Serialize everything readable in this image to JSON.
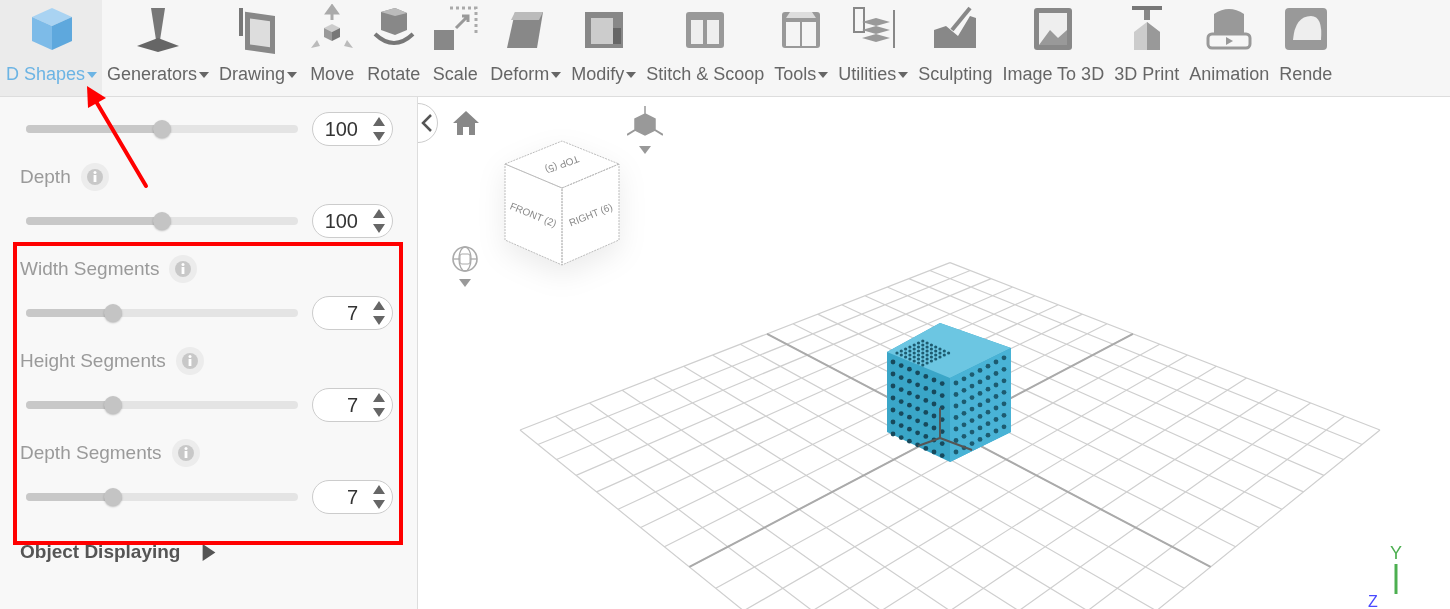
{
  "toolbar": [
    {
      "label": "D Shapes",
      "dropdown": true,
      "selected": true
    },
    {
      "label": "Generators",
      "dropdown": true,
      "selected": false
    },
    {
      "label": "Drawing",
      "dropdown": true,
      "selected": false
    },
    {
      "label": "Move",
      "dropdown": false,
      "selected": false
    },
    {
      "label": "Rotate",
      "dropdown": false,
      "selected": false
    },
    {
      "label": "Scale",
      "dropdown": false,
      "selected": false
    },
    {
      "label": "Deform",
      "dropdown": true,
      "selected": false
    },
    {
      "label": "Modify",
      "dropdown": true,
      "selected": false
    },
    {
      "label": "Stitch & Scoop",
      "dropdown": false,
      "selected": false
    },
    {
      "label": "Tools",
      "dropdown": true,
      "selected": false
    },
    {
      "label": "Utilities",
      "dropdown": true,
      "selected": false
    },
    {
      "label": "Sculpting",
      "dropdown": false,
      "selected": false
    },
    {
      "label": "Image To 3D",
      "dropdown": false,
      "selected": false
    },
    {
      "label": "3D Print",
      "dropdown": false,
      "selected": false
    },
    {
      "label": "Animation",
      "dropdown": false,
      "selected": false
    },
    {
      "label": "Rende",
      "dropdown": false,
      "selected": false
    }
  ],
  "panel": {
    "parameters": [
      {
        "level": 0.5,
        "value": "100"
      },
      {
        "label": "Depth",
        "level": 0.5,
        "value": "100"
      },
      {
        "label": "Width Segments",
        "level": 0.32,
        "value": "7"
      },
      {
        "label": "Height Segments",
        "level": 0.32,
        "value": "7"
      },
      {
        "label": "Depth Segments",
        "level": 0.32,
        "value": "7"
      }
    ],
    "section": {
      "label": "Object Displaying",
      "expanded": false
    }
  },
  "viewport": {
    "view_cube": {
      "top": "TOP (5)",
      "front": "FRONT (2)",
      "right": "RIGHT (6)"
    },
    "axes": {
      "y": "Y",
      "z": "Z"
    }
  },
  "annotations": {
    "arrow": true,
    "highlight_box": true
  }
}
